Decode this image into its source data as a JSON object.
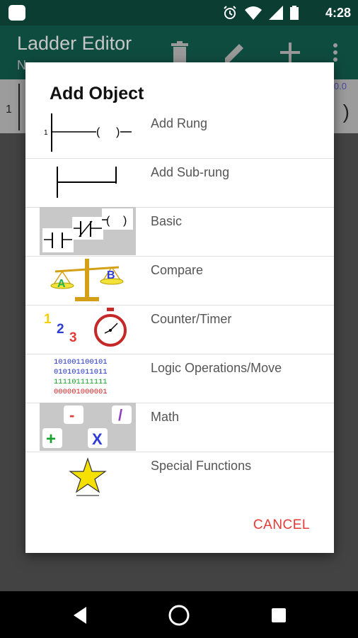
{
  "status_bar": {
    "time": "4:28"
  },
  "toolbar": {
    "title": "Ladder Editor",
    "subtitle": "N"
  },
  "editor": {
    "rung_number": "1",
    "corner_label": "0.0"
  },
  "dialog": {
    "title": "Add Object",
    "items": [
      {
        "label": "Add Rung",
        "icon": "rung-icon"
      },
      {
        "label": "Add Sub-rung",
        "icon": "sub-rung-icon"
      },
      {
        "label": "Basic",
        "icon": "basic-contacts-icon"
      },
      {
        "label": "Compare",
        "icon": "balance-scale-icon"
      },
      {
        "label": "Counter/Timer",
        "icon": "stopwatch-icon"
      },
      {
        "label": "Logic Operations/Move",
        "icon": "binary-icon"
      },
      {
        "label": "Math",
        "icon": "math-operators-icon"
      },
      {
        "label": "Special Functions",
        "icon": "star-icon"
      }
    ],
    "cancel_label": "CANCEL",
    "icon_text": {
      "rung_num": "1",
      "compare_a": "A",
      "compare_b": "B",
      "counter_digits": [
        "1",
        "2",
        "3"
      ],
      "binary_lines": [
        "101001100101",
        "010101011011",
        "111101111111",
        "000001000001"
      ],
      "math_ops": [
        "-",
        "/",
        "+",
        "X"
      ]
    }
  },
  "colors": {
    "accent": "#e53935",
    "toolbar": "#0f4c40",
    "statusbar": "#0b3d33"
  }
}
